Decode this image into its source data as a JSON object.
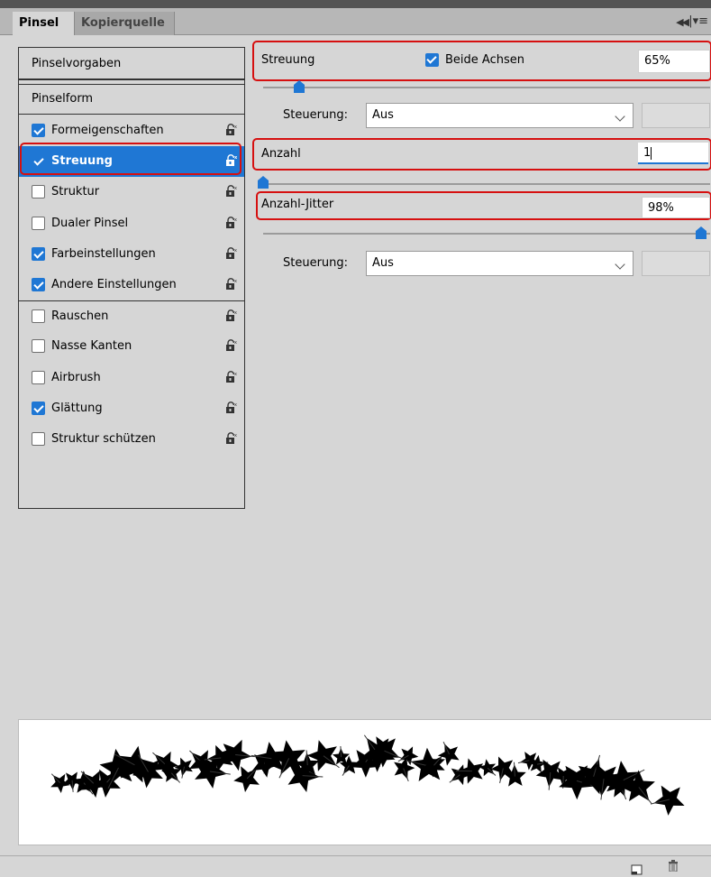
{
  "tabs": {
    "active": "Pinsel",
    "inactive": "Kopierquelle"
  },
  "header_icons": {
    "collapse": "double-chevron-left-icon",
    "menu": "panel-menu-icon"
  },
  "left_list": {
    "presets": "Pinselvorgaben",
    "brush_shape": "Pinselform",
    "options": [
      {
        "label": "Formeigenschaften",
        "checked": true,
        "selected": false
      },
      {
        "label": "Streuung",
        "checked": true,
        "selected": true
      },
      {
        "label": "Struktur",
        "checked": false,
        "selected": false
      },
      {
        "label": "Dualer Pinsel",
        "checked": false,
        "selected": false
      },
      {
        "label": "Farbeinstellungen",
        "checked": true,
        "selected": false
      },
      {
        "label": "Andere Einstellungen",
        "checked": true,
        "selected": false
      },
      {
        "label": "Rauschen",
        "checked": false,
        "selected": false
      },
      {
        "label": "Nasse Kanten",
        "checked": false,
        "selected": false
      },
      {
        "label": "Airbrush",
        "checked": false,
        "selected": false
      },
      {
        "label": "Glättung",
        "checked": true,
        "selected": false
      },
      {
        "label": "Struktur schützen",
        "checked": false,
        "selected": false
      }
    ]
  },
  "scatter": {
    "label": "Streuung",
    "both_axes_label": "Beide Achsen",
    "both_axes_checked": true,
    "value": "65%",
    "level": 0.08,
    "control_label": "Steuerung:",
    "control_value": "Aus"
  },
  "count": {
    "label": "Anzahl",
    "value": "1",
    "level": 0.0
  },
  "count_jitter": {
    "label": "Anzahl-Jitter",
    "value": "98%",
    "level": 0.98,
    "control_label": "Steuerung:",
    "control_value": "Aus"
  },
  "colors": {
    "selection": "#1f77d4",
    "highlight": "#d61010",
    "panel": "#d6d6d6"
  },
  "footer_icons": {
    "new": "new-preset-icon",
    "delete": "trash-icon"
  }
}
